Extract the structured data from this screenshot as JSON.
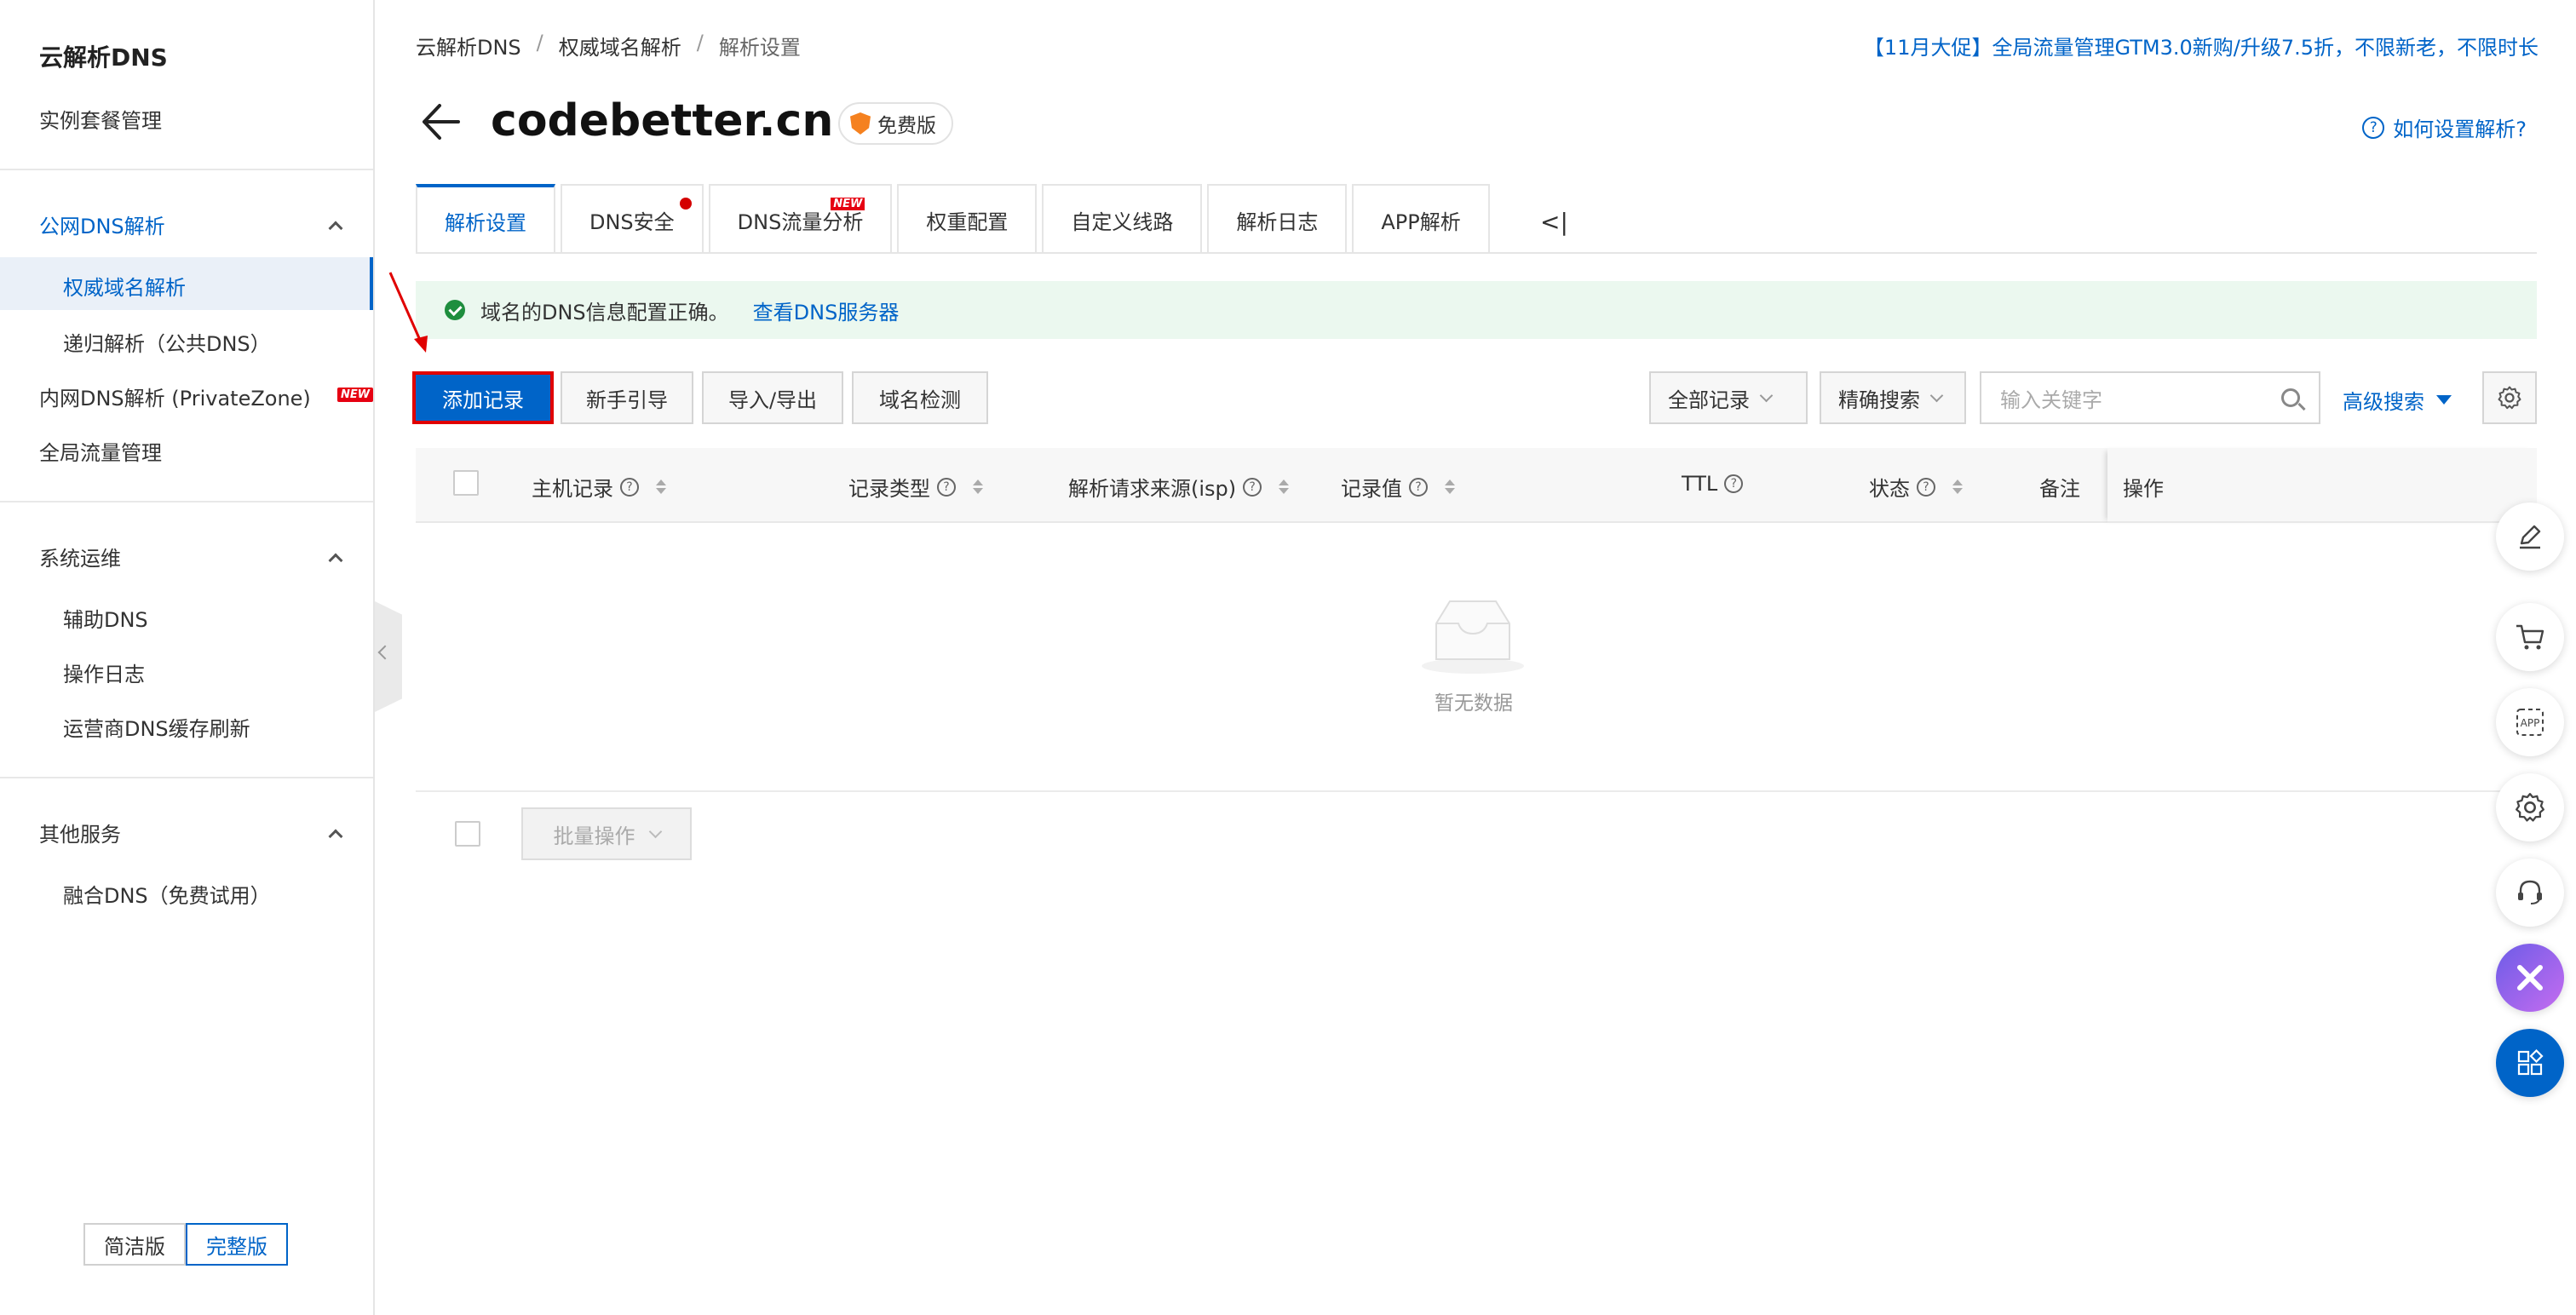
{
  "sidebar": {
    "title": "云解析DNS",
    "instance_mgmt": "实例套餐管理",
    "public_dns": {
      "label": "公网DNS解析",
      "items": [
        "权威域名解析",
        "递归解析（公共DNS）"
      ]
    },
    "private_zone": {
      "label": "内网DNS解析 (PrivateZone)",
      "badge": "NEW"
    },
    "global_traffic": "全局流量管理",
    "ops": {
      "label": "系统运维",
      "items": [
        "辅助DNS",
        "操作日志",
        "运营商DNS缓存刷新"
      ]
    },
    "other": {
      "label": "其他服务",
      "items": [
        "融合DNS（免费试用）"
      ]
    },
    "mode": {
      "simple": "简洁版",
      "full": "完整版"
    }
  },
  "breadcrumb": [
    "云解析DNS",
    "权威域名解析",
    "解析设置"
  ],
  "promo": "【11月大促】全局流量管理GTM3.0新购/升级7.5折，不限新老，不限时长",
  "header": {
    "domain": "codebetter.cn",
    "plan": "免费版",
    "help": "如何设置解析?"
  },
  "tabs": [
    {
      "label": "解析设置",
      "active": true
    },
    {
      "label": "DNS安全",
      "dot": true
    },
    {
      "label": "DNS流量分析",
      "badge": "NEW"
    },
    {
      "label": "权重配置"
    },
    {
      "label": "自定义线路"
    },
    {
      "label": "解析日志"
    },
    {
      "label": "APP解析"
    }
  ],
  "tab_more": "<|",
  "notice": {
    "text": "域名的DNS信息配置正确。",
    "link": "查看DNS服务器"
  },
  "toolbar": {
    "add": "添加记录",
    "guide": "新手引导",
    "import_export": "导入/导出",
    "check": "域名检测",
    "filter": "全部记录",
    "search_mode": "精确搜索",
    "search_placeholder": "输入关键字",
    "advanced": "高级搜索"
  },
  "table": {
    "columns": [
      "主机记录",
      "记录类型",
      "解析请求来源(isp)",
      "记录值",
      "TTL",
      "状态",
      "备注",
      "操作"
    ],
    "empty": "暂无数据"
  },
  "batch": "批量操作",
  "colors": {
    "primary": "#0064c8",
    "success_bg": "#ebf8ef",
    "highlight_red": "#e00000"
  }
}
